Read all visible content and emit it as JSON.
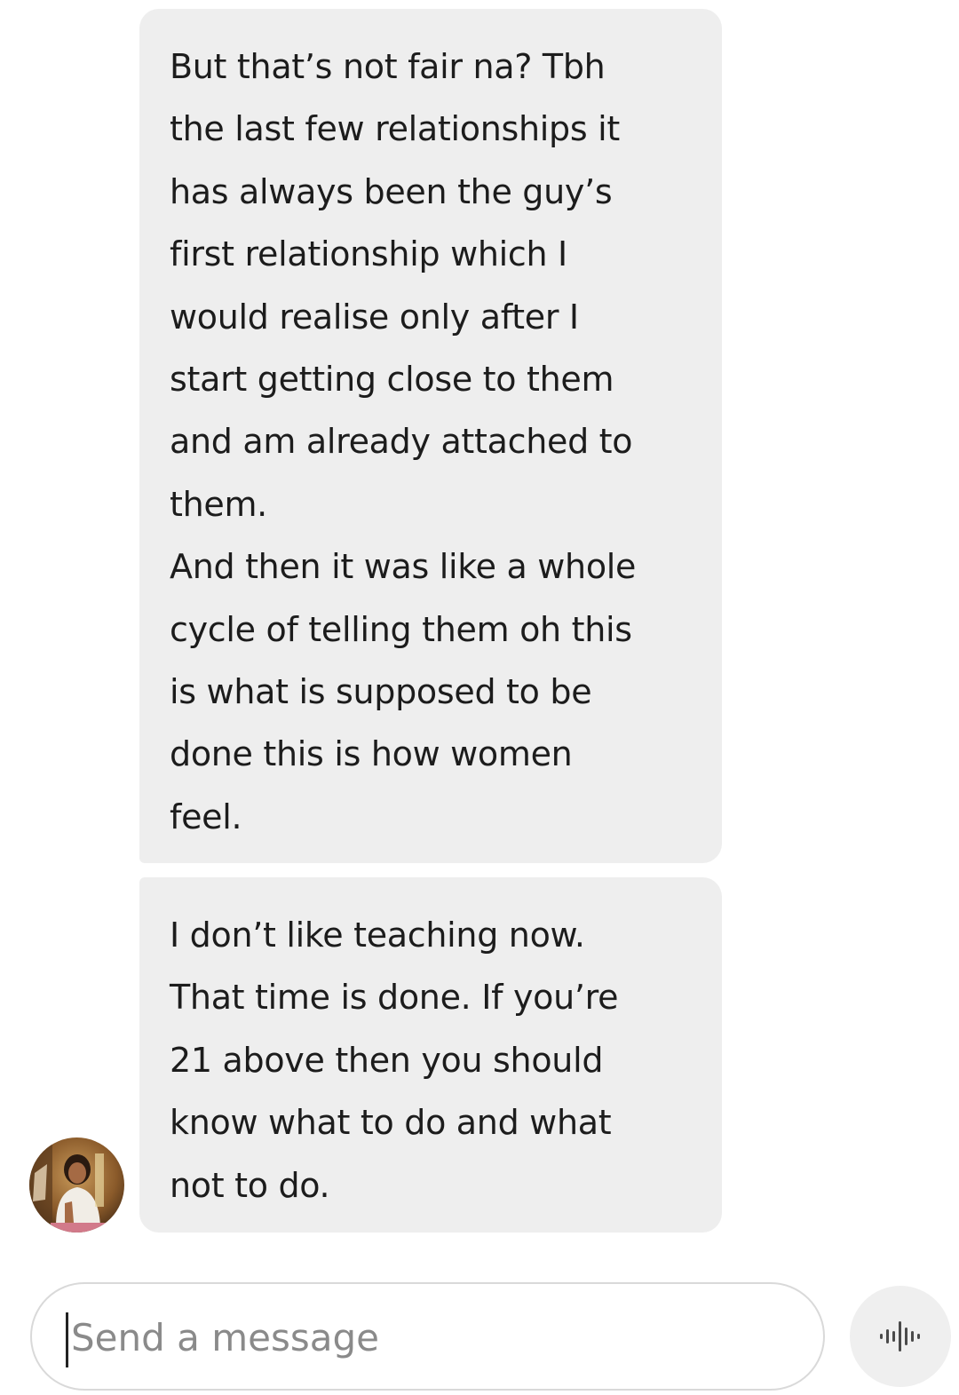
{
  "conversation": {
    "message_1": {
      "lines": [
        "But that’s not fair na? Tbh",
        "the last few relationships it",
        "has always been the guy’s",
        "first relationship which I",
        "would realise only after I",
        "start getting close to them",
        "and am already attached to",
        "them.",
        "And then it was like a whole",
        "cycle of telling them oh this",
        "is what is supposed to be",
        "done this is how women",
        "feel."
      ]
    },
    "message_2": {
      "lines": [
        "I don’t like teaching now.",
        "That time is done. If you’re",
        "21 above then you should",
        "know what to do and what",
        "not to do."
      ]
    },
    "bubble_color": "#eeeeee"
  },
  "composer": {
    "placeholder": "Send a message",
    "voice_icon": "voice-waveform-icon"
  }
}
